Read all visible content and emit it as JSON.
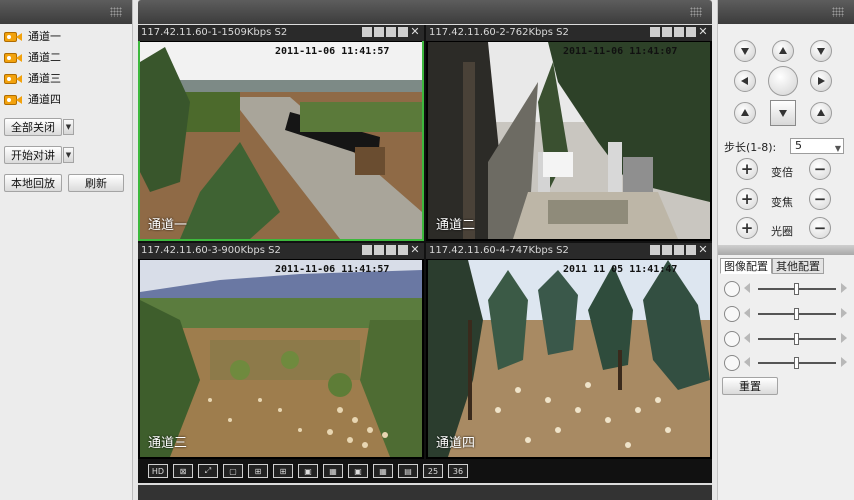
{
  "channels": [
    {
      "label": "通道一"
    },
    {
      "label": "通道二"
    },
    {
      "label": "通道三"
    },
    {
      "label": "通道四"
    }
  ],
  "left_buttons": {
    "close_all": "全部关闭",
    "start_talk": "开始对讲",
    "local_playback": "本地回放",
    "refresh": "刷新"
  },
  "videos": [
    {
      "title": "117.42.11.60-1-1509Kbps S2",
      "timestamp": "2011-11-06 11:41:57",
      "name": "通道一"
    },
    {
      "title": "117.42.11.60-2-762Kbps S2",
      "timestamp": "2011-11-06 11:41:07",
      "name": "通道二"
    },
    {
      "title": "117.42.11.60-3-900Kbps S2",
      "timestamp": "2011-11-06 11:41:57",
      "name": "通道三"
    },
    {
      "title": "117.42.11.60-4-747Kbps S2",
      "timestamp": "2011 11 05 11:41:47",
      "name": "通道四"
    }
  ],
  "layout_toolbar": [
    "HD",
    "",
    "",
    "",
    "",
    "",
    "",
    "",
    "",
    "",
    "",
    "25",
    "36"
  ],
  "ptz": {
    "step_label": "步长(1-8):",
    "step_value": "5",
    "zoom_label": "变倍",
    "focus_label": "变焦",
    "iris_label": "光圈"
  },
  "tabs": {
    "image_config": "图像配置",
    "other_config": "其他配置"
  },
  "image_sliders": [
    {
      "name": "brightness",
      "value": 0.5
    },
    {
      "name": "contrast",
      "value": 0.5
    },
    {
      "name": "saturation",
      "value": 0.5
    },
    {
      "name": "hue",
      "value": 0.5
    }
  ],
  "reset_label": "重置",
  "colors": {
    "selected_border": "#3db83d",
    "camera_icon": "#f2a20d"
  }
}
